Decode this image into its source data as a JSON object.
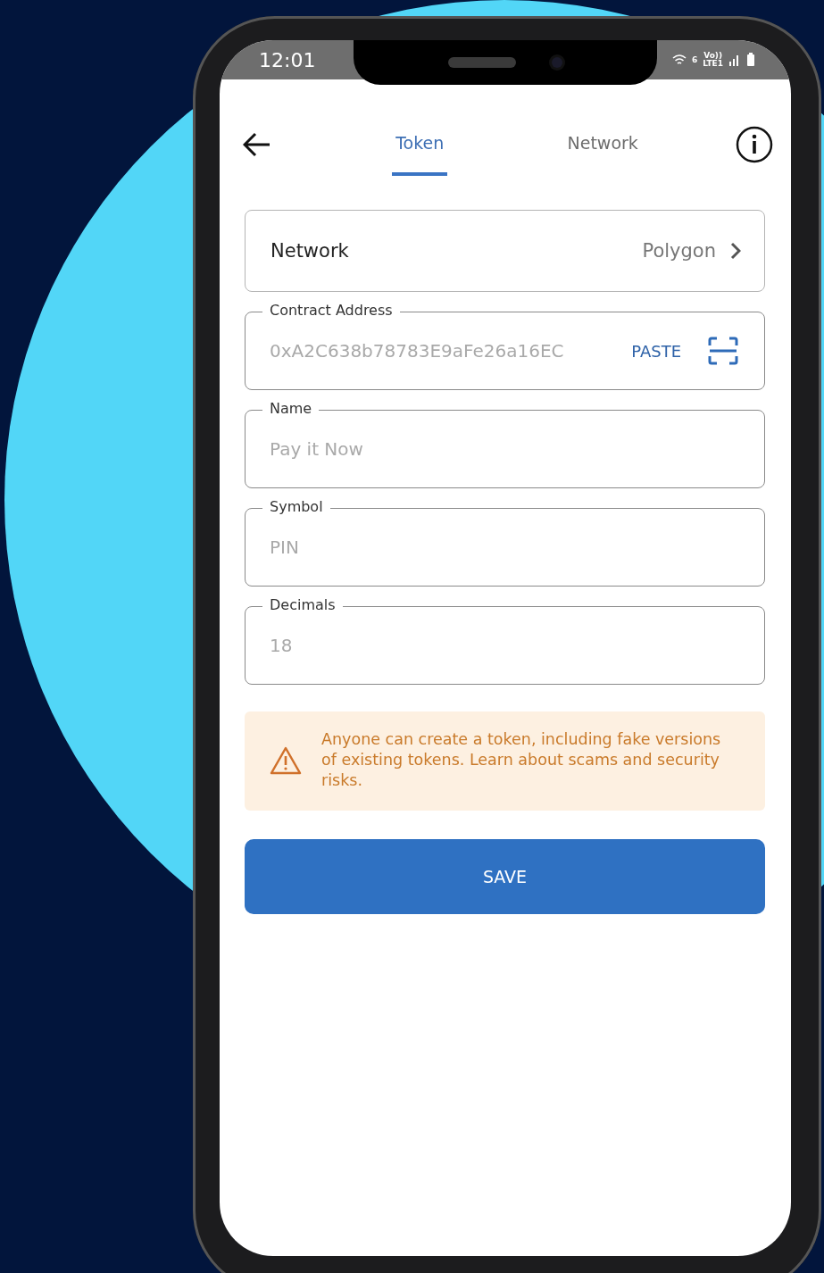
{
  "status_bar": {
    "time": "12:01",
    "wifi_label": "6",
    "volte_label": "Vo))",
    "lte_label": "LTE1"
  },
  "tabs": [
    {
      "label": "Token",
      "selected": true
    },
    {
      "label": "Network",
      "selected": false
    }
  ],
  "network_selector": {
    "label": "Network",
    "value": "Polygon"
  },
  "fields": [
    {
      "kind": "address",
      "label": "Contract Address",
      "placeholder": "0xA2C638b78783E9aFe26a16EC",
      "action": "PASTE"
    },
    {
      "kind": "text",
      "label": "Name",
      "placeholder": "Pay it Now"
    },
    {
      "kind": "text",
      "label": "Symbol",
      "placeholder": "PIN"
    },
    {
      "kind": "text",
      "label": "Decimals",
      "placeholder": "18"
    }
  ],
  "warning": {
    "text": "Anyone can create a token, including fake versions of existing tokens. Learn about scams and security risks."
  },
  "save_button": {
    "label": "SAVE"
  }
}
